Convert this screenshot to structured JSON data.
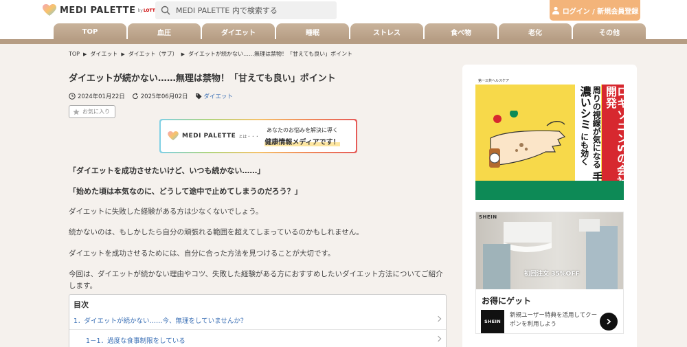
{
  "header": {
    "logo_text": "MEDI PALETTE",
    "logo_by": "by",
    "logo_brand": "LOTTE",
    "search_placeholder": "MEDI PALETTE 内で検索する",
    "login_label": "ログイン / 新規会員登録"
  },
  "nav": {
    "tabs": [
      {
        "label": "TOP"
      },
      {
        "label": "血圧"
      },
      {
        "label": "ダイエット"
      },
      {
        "label": "睡眠"
      },
      {
        "label": "ストレス"
      },
      {
        "label": "食べ物"
      },
      {
        "label": "老化"
      },
      {
        "label": "その他"
      }
    ]
  },
  "breadcrumb": {
    "items": [
      "TOP",
      "ダイエット",
      "ダイエット（サブ）",
      "ダイエットが続かない……無理は禁物！「甘えても良い」ポイント"
    ]
  },
  "article": {
    "title": "ダイエットが続かない……無理は禁物！「甘えても良い」ポイント",
    "published": "2024年01月22日",
    "updated": "2025年06月02日",
    "category": "ダイエット",
    "favorite_label": "お気に入り",
    "banner": {
      "logo": "MEDI PALETTE",
      "toha": "とは・・・",
      "line1": "あなたのお悩みを解決に導く",
      "line2": "健康情報メディアです！"
    },
    "paragraphs_bold": [
      "「ダイエットを成功させたいけど、いつも続かない……」",
      "「始めた頃は本気なのに、どうして途中で止めてしまうのだろう？」"
    ],
    "paragraphs": [
      "ダイエットに失敗した経験がある方は少なくないでしょう。",
      "続かないのは、もしかしたら自分の頑張れる範囲を超えてしまっているのかもしれません。",
      "ダイエットを成功させるためには、自分に合った方法を見つけることが大切です。",
      "今回は、ダイエットが続かない理由やコツ、失敗した経験がある方におすすめしたいダイエット方法についてご紹介します。"
    ],
    "toc": {
      "title": "目次",
      "items": [
        "1．ダイエットが続かない……今、無理をしていませんか？",
        "1－1．過度な食事制限をしている"
      ]
    }
  },
  "sidebar": {
    "ad1": {
      "company": "第一三共ヘルスケア",
      "red_text": "ロキソニンSの会社が開発",
      "white_text_top": "周りの視線が気になる",
      "white_text_big": "手の濃いシミ",
      "white_text_bottom": "にも効く"
    },
    "ad2": {
      "brand_label": "SHEIN",
      "promo": "初回注文 35%OFF",
      "headline": "お得にゲット",
      "logo": "SHEIN",
      "desc": "新規ユーザー特典を活用してクーポンを利用しよう"
    }
  },
  "colors": {
    "nav_tab": "#b69d84",
    "login_button": "#f3b47a",
    "link": "#3a6fb5"
  }
}
